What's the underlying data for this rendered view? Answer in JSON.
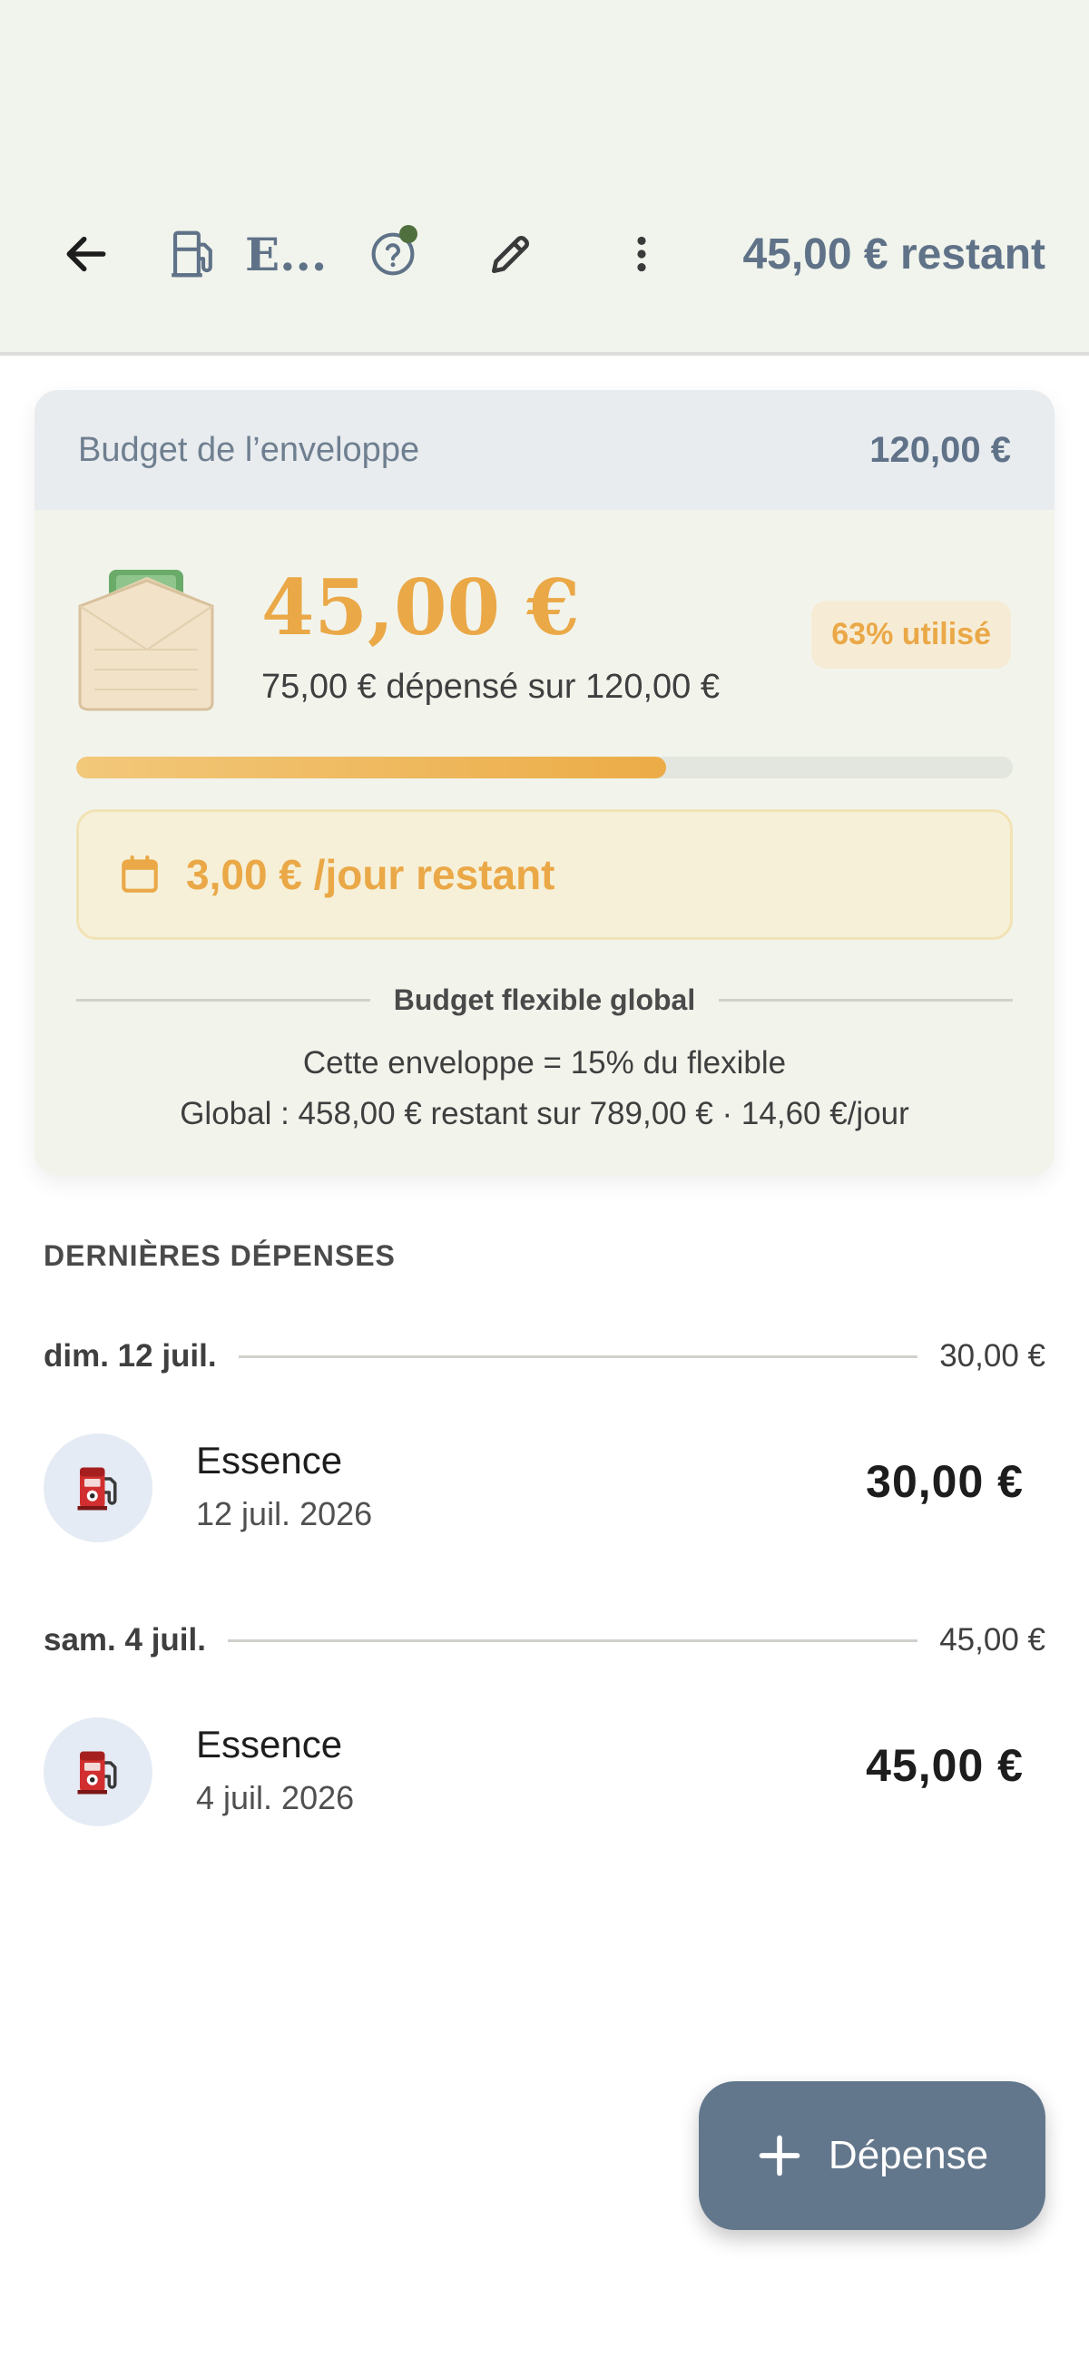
{
  "appbar": {
    "title": "E...",
    "remaining": "45,00 € restant",
    "icons": [
      "back-arrow-icon",
      "fuel-pump-icon",
      "help-icon",
      "edit-pencil-icon",
      "more-vert-icon"
    ],
    "notification_dot_color": "#4f6f3e"
  },
  "budget_card": {
    "header_label": "Budget de l’enveloppe",
    "header_amount": "120,00 €",
    "remaining_amount": "45,00 €",
    "spent_text": "75,00 € dépensé sur 120,00 €",
    "used_chip": "63% utilisé",
    "progress_fraction": 0.63,
    "daily_remaining": "3,00 € /jour restant",
    "flexible_title": "Budget flexible global",
    "flexible_share": "Cette enveloppe = 15% du flexible",
    "global_summary": "Global : 458,00 € restant sur 789,00 € · 14,60 €/jour",
    "accent_color": "#eaa847"
  },
  "expenses": {
    "section_title": "DERNIÈRES DÉPENSES",
    "groups": [
      {
        "day_label": "dim. 12 juil.",
        "day_total": "30,00 €",
        "items": [
          {
            "name": "Essence",
            "date": "12 juil. 2026",
            "amount": "30,00 €",
            "icon": "fuel-pump-icon"
          }
        ]
      },
      {
        "day_label": "sam. 4 juil.",
        "day_total": "45,00 €",
        "items": [
          {
            "name": "Essence",
            "date": "4 juil. 2026",
            "amount": "45,00 €",
            "icon": "fuel-pump-icon"
          }
        ]
      }
    ]
  },
  "fab": {
    "label": "Dépense",
    "icon": "plus-icon",
    "color": "#63778c"
  }
}
